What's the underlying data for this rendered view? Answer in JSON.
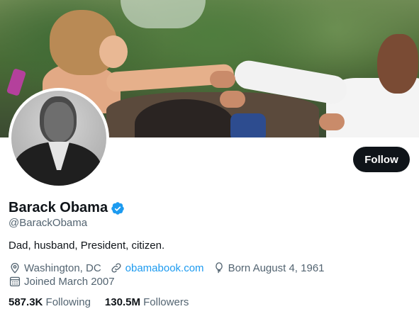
{
  "profile": {
    "name": "Barack Obama",
    "handle": "@BarackObama",
    "bio": "Dad, husband, President, citizen.",
    "location": "Washington, DC",
    "website": "obamabook.com",
    "born": "Born August 4, 1961",
    "joined": "Joined March 2007",
    "verified": true
  },
  "actions": {
    "follow_label": "Follow"
  },
  "stats": {
    "following_count": "587.3K",
    "following_label": "Following",
    "followers_count": "130.5M",
    "followers_label": "Followers"
  },
  "icons": {
    "verified": "verified-badge-icon",
    "location": "location-pin-icon",
    "link": "link-icon",
    "birthday": "balloon-icon",
    "calendar": "calendar-icon"
  },
  "colors": {
    "accent": "#1d9bf0",
    "text": "#0f1419",
    "secondary": "#536471",
    "button": "#0f1419"
  }
}
